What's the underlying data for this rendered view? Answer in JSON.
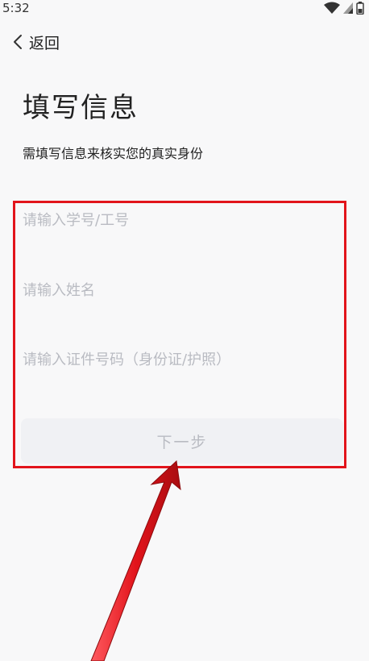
{
  "status_bar": {
    "time": "5:32"
  },
  "nav": {
    "back_label": "返回"
  },
  "page": {
    "title": "填写信息",
    "subtitle": "需填写信息来核实您的真实身份"
  },
  "form": {
    "student_id": {
      "value": "",
      "placeholder": "请输入学号/工号"
    },
    "name": {
      "value": "",
      "placeholder": "请输入姓名"
    },
    "id_number": {
      "value": "",
      "placeholder": "请输入证件号码（身份证/护照）"
    },
    "next_label": "下一步"
  },
  "colors": {
    "background": "#f8f8f9",
    "placeholder": "#b9bbc2",
    "button_bg": "#f0f1f4",
    "annotation_red": "#e2141b"
  },
  "icons": [
    "wifi-icon",
    "cell-signal-icon",
    "battery-icon",
    "back-chevron-icon",
    "annotation-arrow"
  ]
}
